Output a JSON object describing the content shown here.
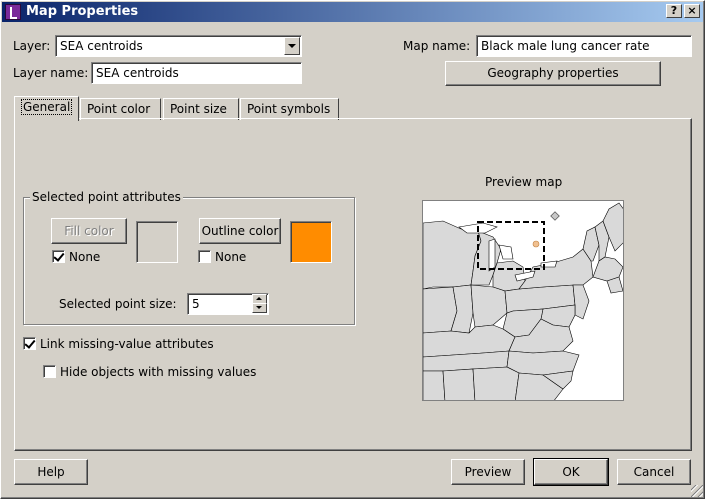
{
  "window": {
    "title": "Map Properties",
    "help_glyph": "?",
    "close_glyph": "×"
  },
  "header": {
    "layer_label": "Layer:",
    "layer_value": "SEA centroids",
    "layer_name_label": "Layer name:",
    "layer_name_value": "SEA centroids",
    "map_name_label": "Map name:",
    "map_name_value": "Black male lung cancer rate",
    "geography_button": "Geography properties"
  },
  "tabs": [
    {
      "label": "General",
      "active": true
    },
    {
      "label": "Point color",
      "active": false
    },
    {
      "label": "Point size",
      "active": false
    },
    {
      "label": "Point symbols",
      "active": false
    }
  ],
  "general": {
    "group_title": "Selected point attributes",
    "fill_color_button": "Fill color",
    "fill_none_label": "None",
    "fill_none_checked": true,
    "fill_swatch_color": "#d4d0c8",
    "outline_color_button": "Outline color",
    "outline_none_label": "None",
    "outline_none_checked": false,
    "outline_swatch_color": "#ff8c00",
    "point_size_label": "Selected point size:",
    "point_size_value": "5",
    "link_missing_label": "Link missing-value attributes",
    "link_missing_checked": true,
    "hide_missing_label": "Hide objects with missing values",
    "hide_missing_checked": false,
    "preview_title": "Preview map"
  },
  "footer": {
    "help_button": "Help",
    "preview_button": "Preview",
    "ok_button": "OK",
    "cancel_button": "Cancel"
  },
  "colors": {
    "title_start": "#0a246a",
    "title_end": "#a6caf0",
    "face": "#d4d0c8",
    "accent_orange": "#ff8c00",
    "map_fill": "#d9d9d9"
  }
}
